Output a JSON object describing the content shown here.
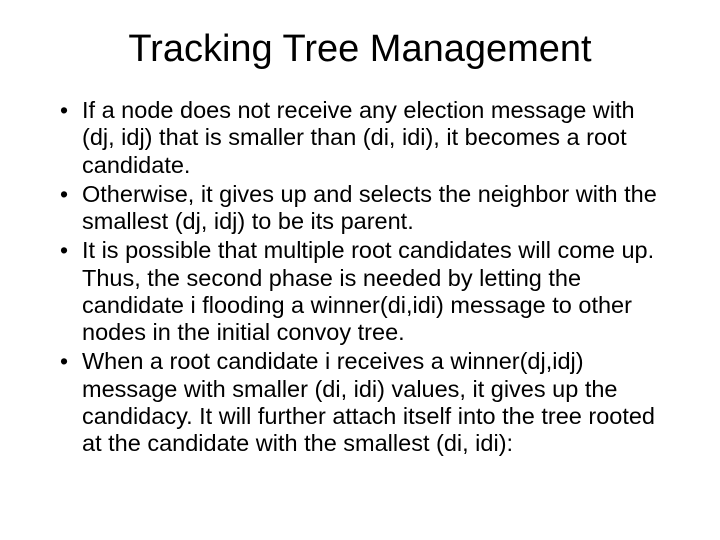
{
  "title": "Tracking Tree Management",
  "bullets": [
    "If a node does not receive any election message with (dj, idj) that is smaller than (di, idi), it becomes a root candidate.",
    "Otherwise, it gives up and selects the neighbor with the smallest (dj, idj) to be its parent.",
    "It is possible that multiple root candidates will come up. Thus, the second phase is needed by letting the candidate i flooding a winner(di,idi) message to other nodes in the initial convoy tree.",
    "When a root candidate i receives a winner(dj,idj) message with smaller (di, idi) values, it gives up the candidacy. It will further attach itself into the tree rooted at the candidate with the smallest (di, idi):"
  ]
}
